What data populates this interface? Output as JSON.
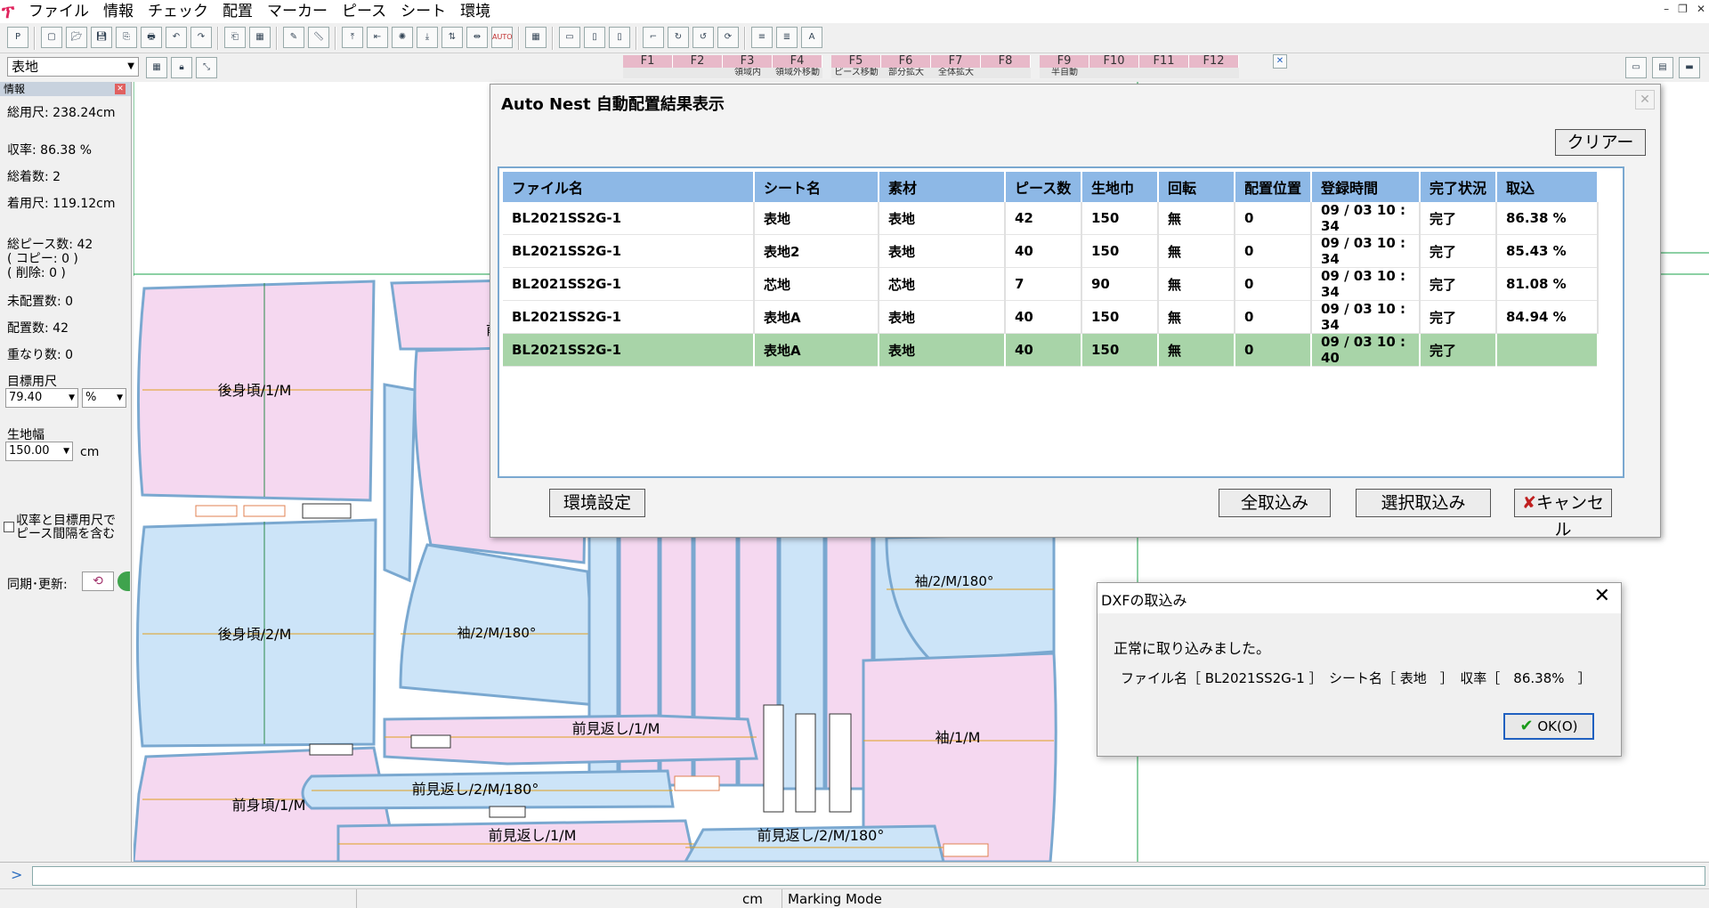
{
  "menu": [
    "ファイル",
    "情報",
    "チェック",
    "配置",
    "マーカー",
    "ピース",
    "シート",
    "環境"
  ],
  "toolbar_icons": [
    "plotter-icon",
    "new-file-icon",
    "open-folder-icon",
    "save-icon",
    "save-as-icon",
    "print-icon",
    "undo-icon",
    "redo-icon",
    "copy-sheet-icon",
    "grid-table-icon",
    "pencil-edit-icon",
    "ruler-icon",
    "align-up-icon",
    "align-left-icon",
    "explode-icon",
    "align-down-icon",
    "flip-icon",
    "align-center-icon",
    "auto-icon",
    "table-icon",
    "shape-icon",
    "piece-icon",
    "piece-alt-icon",
    "fold-icon",
    "rotate-icon",
    "rotate-alt-icon",
    "rotate-three-icon",
    "list-icon",
    "list-alt-icon",
    "text-icon"
  ],
  "auto_label": "AUTO",
  "fabric_select": "表地",
  "fkeys": [
    {
      "key": "F1",
      "sub": ""
    },
    {
      "key": "F2",
      "sub": ""
    },
    {
      "key": "F3",
      "sub": "領域内"
    },
    {
      "key": "F4",
      "sub": "領域外移動"
    },
    {
      "key": "F5",
      "sub": "ピース移動"
    },
    {
      "key": "F6",
      "sub": "部分拡大"
    },
    {
      "key": "F7",
      "sub": "全体拡大"
    },
    {
      "key": "F8",
      "sub": ""
    },
    {
      "key": "F9",
      "sub": "半自動"
    },
    {
      "key": "F10",
      "sub": ""
    },
    {
      "key": "F11",
      "sub": ""
    },
    {
      "key": "F12",
      "sub": ""
    }
  ],
  "info_panel": {
    "header": "情報",
    "total_length": "総用尺: 238.24cm",
    "yield": "収率: 86.38 %",
    "total_count": "総着数: 2",
    "unit_length": "着用尺: 119.12cm",
    "total_pieces": "総ピース数: 42",
    "copy": "( コピー: 0 )",
    "deleted": "( 削除: 0 )",
    "unplaced": "未配置数: 0",
    "placed": "配置数: 42",
    "overlap": "重なり数: 0",
    "target_label": "目標用尺",
    "target_value": "79.40",
    "target_unit": "%",
    "width_label": "生地幅",
    "width_value": "150.00",
    "width_unit": "cm",
    "include_label_1": "収率と目標用尺で",
    "include_label_2": "ピース間隔を含む",
    "sync_label": "同期･更新:"
  },
  "pieces": [
    {
      "label": "後身頃/1/M"
    },
    {
      "label": "前"
    },
    {
      "label": "後身頃/2/M"
    },
    {
      "label": "袖/2/M/180°"
    },
    {
      "label": "袖/2/M/180°"
    },
    {
      "label": "袖/1/M"
    },
    {
      "label": "前見返し/1/M"
    },
    {
      "label": "前見返し/2/M/180°"
    },
    {
      "label": "前身頃/1/M"
    },
    {
      "label": "前見返し/1/M"
    },
    {
      "label": "前見返し/2/M/180°"
    }
  ],
  "nest_dialog": {
    "title": "Auto Nest 自動配置結果表示",
    "clear": "クリアー",
    "columns": [
      "ファイル名",
      "シート名",
      "素材",
      "ピース数",
      "生地巾",
      "回転",
      "配置位置",
      "登録時間",
      "完了状況",
      "取込"
    ],
    "rows": [
      [
        "BL2021SS2G-1",
        "表地",
        "表地",
        "42",
        "150",
        "無",
        "0",
        "09 / 03 10 : 34",
        "完了",
        "86.38 %"
      ],
      [
        "BL2021SS2G-1",
        "表地2",
        "表地",
        "40",
        "150",
        "無",
        "0",
        "09 / 03 10 : 34",
        "完了",
        "85.43 %"
      ],
      [
        "BL2021SS2G-1",
        "芯地",
        "芯地",
        "7",
        "90",
        "無",
        "0",
        "09 / 03 10 : 34",
        "完了",
        "81.08 %"
      ],
      [
        "BL2021SS2G-1",
        "表地A",
        "表地",
        "40",
        "150",
        "無",
        "0",
        "09 / 03 10 : 34",
        "完了",
        "84.94 %"
      ],
      [
        "BL2021SS2G-1",
        "表地A",
        "表地",
        "40",
        "150",
        "無",
        "0",
        "09 / 03 10 : 40",
        "完了",
        ""
      ]
    ],
    "settings": "環境設定",
    "import_all": "全取込み",
    "import_selected": "選択取込み",
    "cancel": "キャンセル"
  },
  "dxf_dialog": {
    "title": "DXFの取込み",
    "message": "正常に取り込みました。",
    "detail": "ファイル名［ BL2021SS2G-1 ］　シート名［ 表地　］　収率［　86.38%　］",
    "ok": "OK(O)"
  },
  "status": {
    "unit": "cm",
    "mode": "Marking Mode"
  },
  "colors": {
    "pink_piece": "#f5d8f0",
    "blue_piece": "#cce4f8",
    "header_blue": "#8db8e6",
    "selected_row": "#a8d4a8"
  }
}
